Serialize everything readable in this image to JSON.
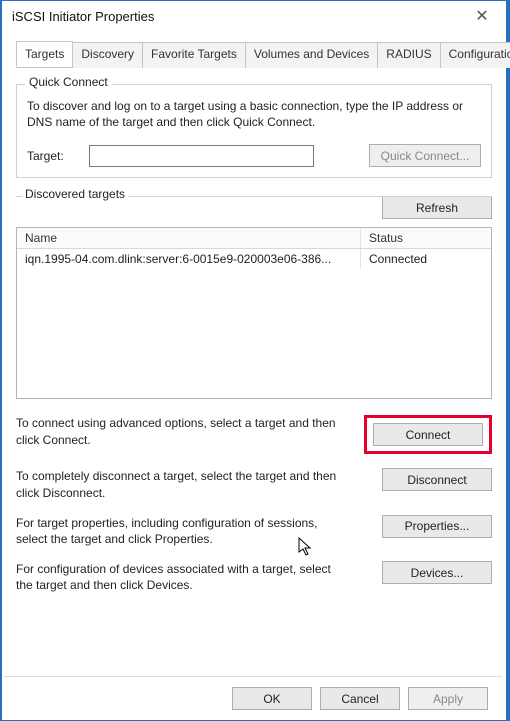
{
  "window": {
    "title": "iSCSI Initiator Properties"
  },
  "tabs": {
    "targets": "Targets",
    "discovery": "Discovery",
    "favorites": "Favorite Targets",
    "volumes": "Volumes and Devices",
    "radius": "RADIUS",
    "configuration": "Configuration"
  },
  "quick_connect": {
    "legend": "Quick Connect",
    "desc": "To discover and log on to a target using a basic connection, type the IP address or DNS name of the target and then click Quick Connect.",
    "target_label": "Target:",
    "target_value": "",
    "button": "Quick Connect..."
  },
  "discovered": {
    "legend": "Discovered targets",
    "refresh": "Refresh",
    "columns": {
      "name": "Name",
      "status": "Status"
    },
    "rows": [
      {
        "name": "iqn.1995-04.com.dlink:server:6-0015e9-020003e06-386...",
        "status": "Connected"
      }
    ]
  },
  "help": {
    "connect_text": "To connect using advanced options, select a target and then click Connect.",
    "connect_btn": "Connect",
    "disconnect_text": "To completely disconnect a target, select the target and then click Disconnect.",
    "disconnect_btn": "Disconnect",
    "properties_text": "For target properties, including configuration of sessions, select the target and click Properties.",
    "properties_btn": "Properties...",
    "devices_text": "For configuration of devices associated with a target, select the target and then click Devices.",
    "devices_btn": "Devices..."
  },
  "buttons": {
    "ok": "OK",
    "cancel": "Cancel",
    "apply": "Apply"
  }
}
